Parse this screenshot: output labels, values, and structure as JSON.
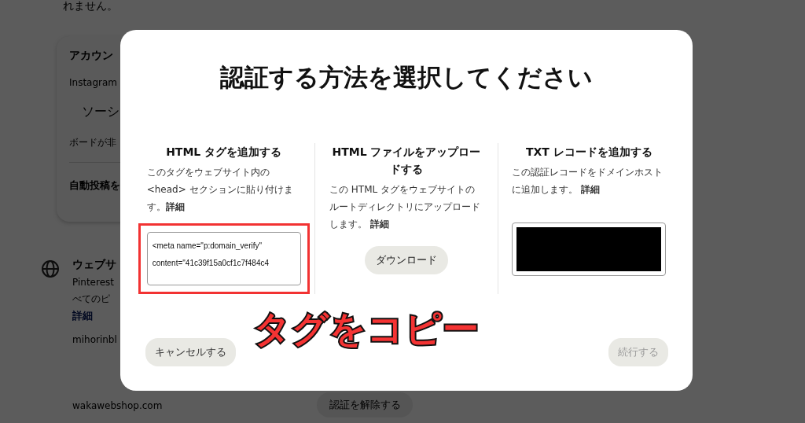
{
  "background": {
    "intro_tail": "れません。",
    "account_card": {
      "heading": "アカウン",
      "instagram_label": "Instagram",
      "social_button": "ソーシ",
      "board_note": "ボードが非",
      "autopost_label": "自動投稿を"
    },
    "website_section": {
      "heading": "ウェブサ",
      "description_lines": [
        "Pinterest",
        "べてのピ"
      ],
      "details_link": "詳細",
      "domains": [
        "mihorinbl",
        "wakawebshop.com"
      ],
      "unverify_button": "認証を解除する"
    }
  },
  "dialog": {
    "title": "認証する方法を選択してください",
    "methods": [
      {
        "kind": "code",
        "heading": "HTML タグを追加する",
        "description": "このタグをウェブサイト内の <head> セクションに貼り付けます。**詳細**",
        "code": "<meta name=\"p:domain_verify\" content=\"41c39f15a0cf1c7f484c4",
        "highlighted": true
      },
      {
        "kind": "download",
        "heading": "HTML ファイルをアップロードする",
        "description": "この HTML タグをウェブサイトのルートディレクトリにアップロードします。 **詳細**",
        "button_label": "ダウンロード",
        "highlighted": false
      },
      {
        "kind": "redacted",
        "heading": "TXT レコードを追加する",
        "description": "この認証レコードをドメインホストに追加します。 **詳細**",
        "highlighted": false
      }
    ],
    "cancel_button": {
      "label": "キャンセルする",
      "disabled": false
    },
    "continue_button": {
      "label": "続行する",
      "disabled": true
    }
  },
  "annotation": {
    "text": "タグをコピー"
  }
}
